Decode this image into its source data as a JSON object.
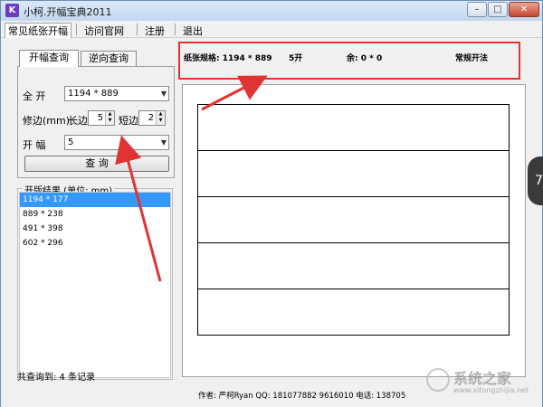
{
  "window": {
    "title": "小柯.开幅宝典2011",
    "app_icon_letter": "K",
    "minimize": "–",
    "maximize": "□",
    "close": "✕"
  },
  "menu": {
    "items": [
      "常见纸张开幅",
      "访问官网",
      "注册",
      "退出"
    ]
  },
  "tabs": [
    "开幅查询",
    "逆向查询"
  ],
  "form": {
    "full_label": "全  开",
    "full_value": "1194 * 889",
    "trim_label": "修边(mm)",
    "long_label": "长边",
    "long_value": "5",
    "short_label": "短边",
    "short_value": "2",
    "sheets_label": "开  幅",
    "sheets_value": "5",
    "query_button": "查  询"
  },
  "results": {
    "group_title": "开版结果 (单位: mm)",
    "items": [
      "1194 * 177",
      "889 * 238",
      "491 * 398",
      "602 * 296"
    ],
    "selected_index": 0,
    "footer": "共查询到: 4 条记录"
  },
  "info": {
    "spec": "纸张规格: 1194 * 889",
    "sheets": "5开",
    "remainder": "余: 0 * 0",
    "method": "常规开法"
  },
  "sheet_divisions": 5,
  "footer_author": "作者: 严柯Ryan QQ: 181077882 9616010 电话: 138705 ",
  "side_tab": "7",
  "watermark": {
    "text": "系统之家",
    "url": "www.xitongzhijia.net"
  },
  "colors": {
    "highlight_border": "#e03434",
    "arrow": "#e03434",
    "selection": "#3399ff"
  }
}
